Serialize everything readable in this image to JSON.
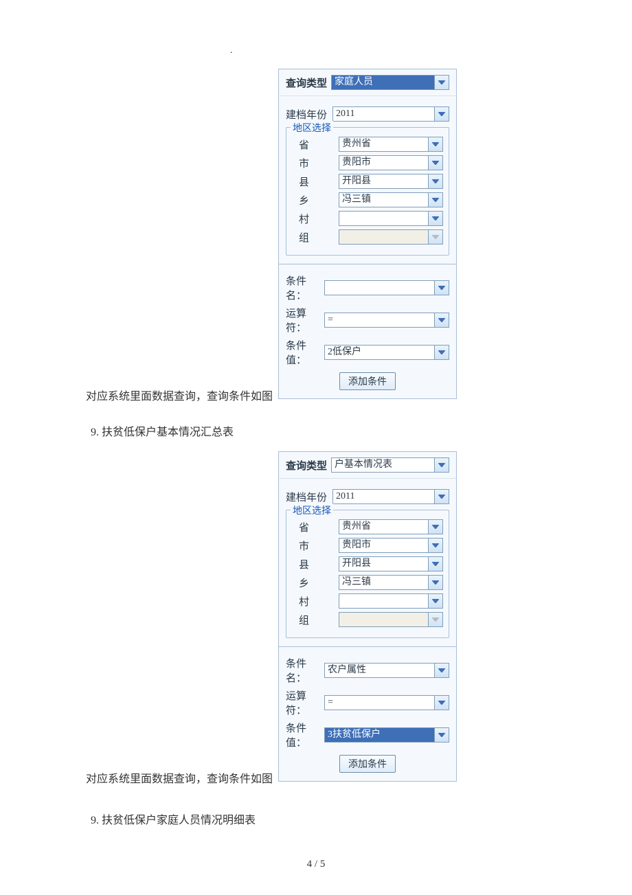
{
  "captions": {
    "intro": "对应系统里面数据查询，查询条件如图",
    "intro2": "对应系统里面数据查询，查询条件如图",
    "section9a": "9.  扶贫低保户基本情况汇总表",
    "section9b": "9.    扶贫低保户家庭人员情况明细表"
  },
  "page_number": "4 / 5",
  "form1": {
    "query_type_label": "查询类型",
    "query_type_value": "家庭人员",
    "year_label": "建档年份",
    "year_value": "2011",
    "region_legend": "地区选择",
    "region": {
      "province_label": "省",
      "province_value": "贵州省",
      "city_label": "市",
      "city_value": "贵阳市",
      "county_label": "县",
      "county_value": "开阳县",
      "town_label": "乡",
      "town_value": "冯三镇",
      "village_label": "村",
      "village_value": "",
      "group_label": "组",
      "group_value": ""
    },
    "cond_name_label": "条件名：",
    "cond_name_value": "",
    "cond_op_label": "运算符：",
    "cond_op_value": "=",
    "cond_val_label": "条件值：",
    "cond_val_value": "2低保户",
    "add_button": "添加条件"
  },
  "form2": {
    "query_type_label": "查询类型",
    "query_type_value": "户基本情况表",
    "year_label": "建档年份",
    "year_value": "2011",
    "region_legend": "地区选择",
    "region": {
      "province_label": "省",
      "province_value": "贵州省",
      "city_label": "市",
      "city_value": "贵阳市",
      "county_label": "县",
      "county_value": "开阳县",
      "town_label": "乡",
      "town_value": "冯三镇",
      "village_label": "村",
      "village_value": "",
      "group_label": "组",
      "group_value": ""
    },
    "cond_name_label": "条件名：",
    "cond_name_value": "农户属性",
    "cond_op_label": "运算符：",
    "cond_op_value": "=",
    "cond_val_label": "条件值：",
    "cond_val_value": "3扶贫低保户",
    "add_button": "添加条件"
  }
}
